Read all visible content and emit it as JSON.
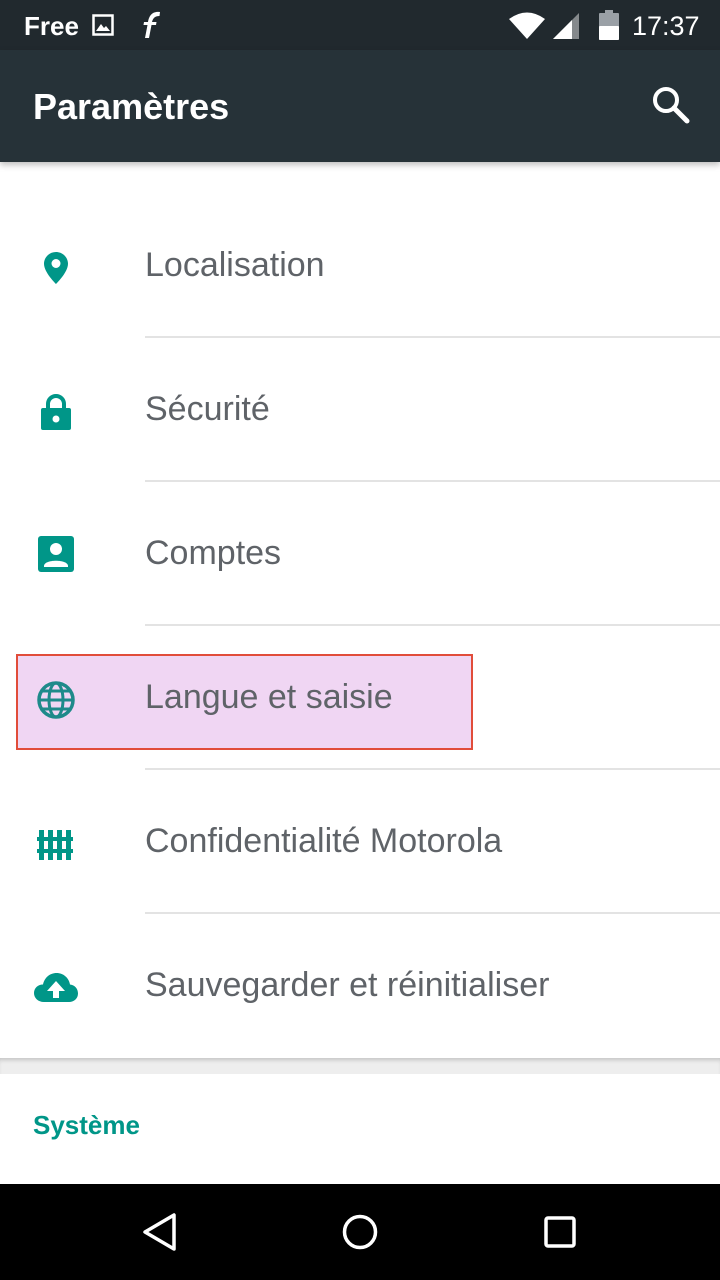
{
  "status_bar": {
    "carrier": "Free",
    "time": "17:37",
    "icons": [
      "image-icon",
      "flash-icon",
      "wifi-icon",
      "signal-icon",
      "battery-icon"
    ]
  },
  "app_bar": {
    "title": "Paramètres",
    "search_icon": "search-icon"
  },
  "colors": {
    "status_bar": "#21292e",
    "app_bar": "#263238",
    "accent": "#009688",
    "text": "#5f6368",
    "highlight_fill": "#f0d6f3",
    "highlight_border": "#e14d3a"
  },
  "settings": {
    "items": [
      {
        "label": "Localisation",
        "icon": "location-pin-icon"
      },
      {
        "label": "Sécurité",
        "icon": "lock-icon"
      },
      {
        "label": "Comptes",
        "icon": "account-icon"
      },
      {
        "label": "Langue et saisie",
        "icon": "globe-icon",
        "highlighted": true
      },
      {
        "label": "Confidentialité Motorola",
        "icon": "fence-icon"
      },
      {
        "label": "Sauvegarder et réinitialiser",
        "icon": "cloud-upload-icon"
      }
    ]
  },
  "sections": {
    "system": "Système"
  },
  "nav_bar": {
    "buttons": [
      "back-icon",
      "home-icon",
      "recents-icon"
    ]
  }
}
